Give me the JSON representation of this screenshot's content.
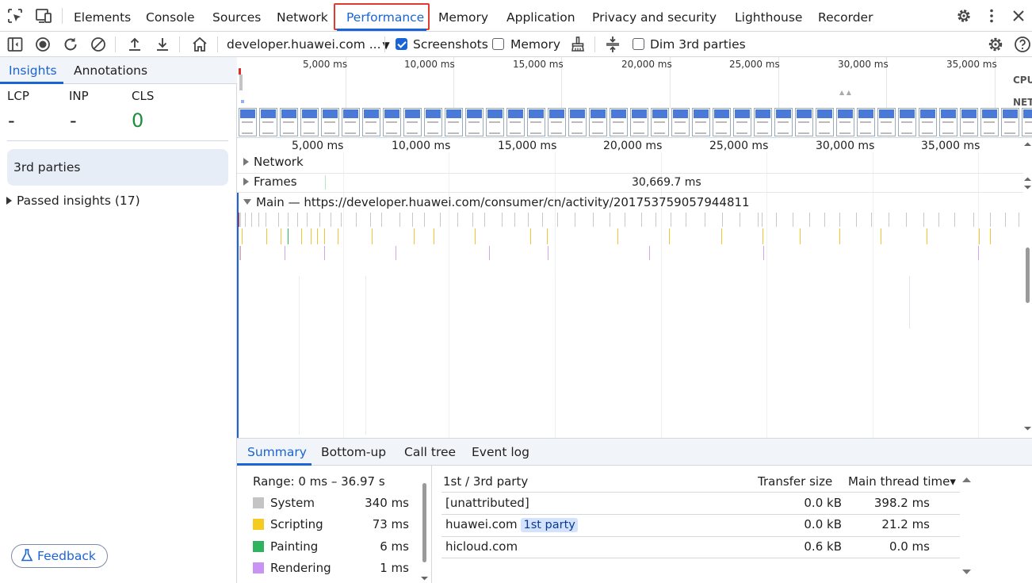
{
  "tabs": {
    "items": [
      "Elements",
      "Console",
      "Sources",
      "Network",
      "Performance",
      "Memory",
      "Application",
      "Privacy and security",
      "Lighthouse",
      "Recorder"
    ],
    "active": "Performance"
  },
  "toolbar": {
    "url_select": "developer.huawei.com ...",
    "screenshots_label": "Screenshots",
    "memory_label": "Memory",
    "dim_label": "Dim 3rd parties"
  },
  "left": {
    "tabs": [
      "Insights",
      "Annotations"
    ],
    "metrics": [
      {
        "label": "LCP",
        "value": "-"
      },
      {
        "label": "INP",
        "value": "-"
      },
      {
        "label": "CLS",
        "value": "0"
      }
    ],
    "third_parties": "3rd parties",
    "passed": "Passed insights (17)",
    "feedback": "Feedback"
  },
  "timeline": {
    "overview_ticks": [
      "5,000 ms",
      "10,000 ms",
      "15,000 ms",
      "20,000 ms",
      "25,000 ms",
      "30,000 ms",
      "35,000 ms"
    ],
    "main_ticks": [
      "5,000 ms",
      "10,000 ms",
      "15,000 ms",
      "20,000 ms",
      "25,000 ms",
      "30,000 ms",
      "35,000 ms"
    ],
    "cpu_label": "CPU",
    "net_label": "NET",
    "network_track": "Network",
    "frames_track": "Frames",
    "frames_value": "30,669.7 ms",
    "main_track": "Main — https://developer.huawei.com/consumer/cn/activity/201753759057944811"
  },
  "bottom": {
    "tabs": [
      "Summary",
      "Bottom-up",
      "Call tree",
      "Event log"
    ],
    "range": "Range: 0 ms – 36.97 s",
    "summary": [
      {
        "label": "System",
        "value": "340 ms",
        "color": "#c4c4c4"
      },
      {
        "label": "Scripting",
        "value": "73 ms",
        "color": "#f5cb21"
      },
      {
        "label": "Painting",
        "value": "6 ms",
        "color": "#2fb35e"
      },
      {
        "label": "Rendering",
        "value": "1 ms",
        "color": "#c993f5"
      }
    ],
    "table": {
      "headers": [
        "1st / 3rd party",
        "Transfer size",
        "Main thread time▾"
      ],
      "rows": [
        {
          "name": "[unattributed]",
          "badge": "",
          "transfer": "0.0 kB",
          "time": "398.2 ms"
        },
        {
          "name": "huawei.com",
          "badge": "1st party",
          "transfer": "0.0 kB",
          "time": "21.2 ms"
        },
        {
          "name": "hicloud.com",
          "badge": "",
          "transfer": "0.6 kB",
          "time": "0.0 ms"
        }
      ]
    }
  },
  "colors": {
    "accent": "#1a64d6",
    "highlight": "#e33a2f",
    "cls_good": "#1e8e3e"
  }
}
